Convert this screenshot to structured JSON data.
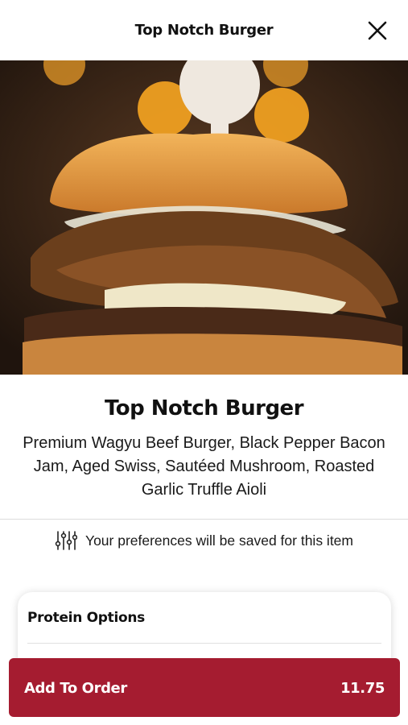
{
  "header": {
    "title": "Top Notch Burger"
  },
  "item": {
    "name": "Top Notch Burger",
    "description": "Premium Wagyu Beef Burger, Black Pepper Bacon Jam, Aged Swiss, Sautéed Mushroom, Roasted Garlic Truffle Aioli"
  },
  "preferences": {
    "text": "Your preferences will be saved for this item",
    "icon": "sliders-icon"
  },
  "options": {
    "title": "Protein Options"
  },
  "cta": {
    "label": "Add To Order",
    "price": "11.75"
  },
  "colors": {
    "accent": "#a51c30",
    "text": "#111111",
    "divider": "#dcdcdc"
  }
}
